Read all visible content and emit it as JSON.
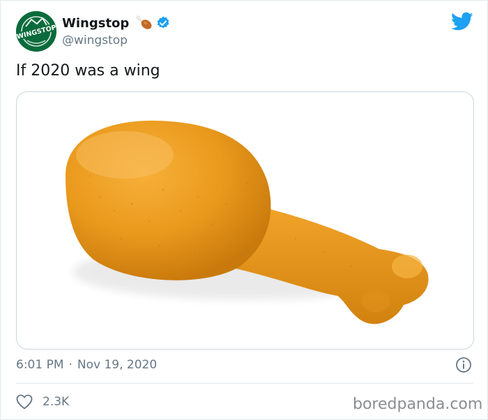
{
  "tweet": {
    "display_name": "Wingstop",
    "handle": "@wingstop",
    "text": "If 2020 was a wing",
    "time": "6:01 PM",
    "separator": "·",
    "date": "Nov 19, 2020",
    "like_count": "2.3K"
  },
  "avatar": {
    "logo_text": "WINGSTOP"
  },
  "icons": {
    "name_emoji": "poultry-leg-icon",
    "verified": "verified-badge-icon",
    "brand": "twitter-bird-icon",
    "info": "info-icon",
    "like": "heart-icon"
  },
  "media": {
    "subject": "chicken drumstick"
  },
  "watermark": "boredpanda.com",
  "colors": {
    "text_primary": "#14171a",
    "text_secondary": "#657786",
    "twitter_blue": "#1da1f2",
    "avatar_green": "#0a6b3c",
    "border": "#ccd6dd"
  }
}
